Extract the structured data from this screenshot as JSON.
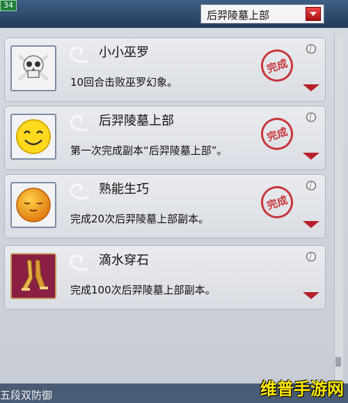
{
  "top": {
    "badge": "34",
    "dropdown_value": "后羿陵墓上部"
  },
  "achievements": [
    {
      "title": "小小巫罗",
      "desc": "10回合击败巫罗幻象。",
      "stamp": "完成",
      "icon": "skull-crossbones-icon"
    },
    {
      "title": "后羿陵墓上部",
      "desc": "第一次完成副本“后羿陵墓上部”。",
      "stamp": "完成",
      "icon": "smiley-face-icon"
    },
    {
      "title": "熟能生巧",
      "desc": "完成20次后羿陵墓上部副本。",
      "stamp": "完成",
      "icon": "sleepy-sun-face-icon"
    },
    {
      "title": "滴水穿石",
      "desc": "完成100次后羿陵墓上部副本。",
      "stamp": "",
      "icon": "golden-legs-icon"
    }
  ],
  "bottom": {
    "text": "五段双防御"
  },
  "watermark": "维普手游网",
  "colors": {
    "stamp": "#c4252a",
    "arrow": "#b7202a",
    "header": "#2f4d72"
  }
}
